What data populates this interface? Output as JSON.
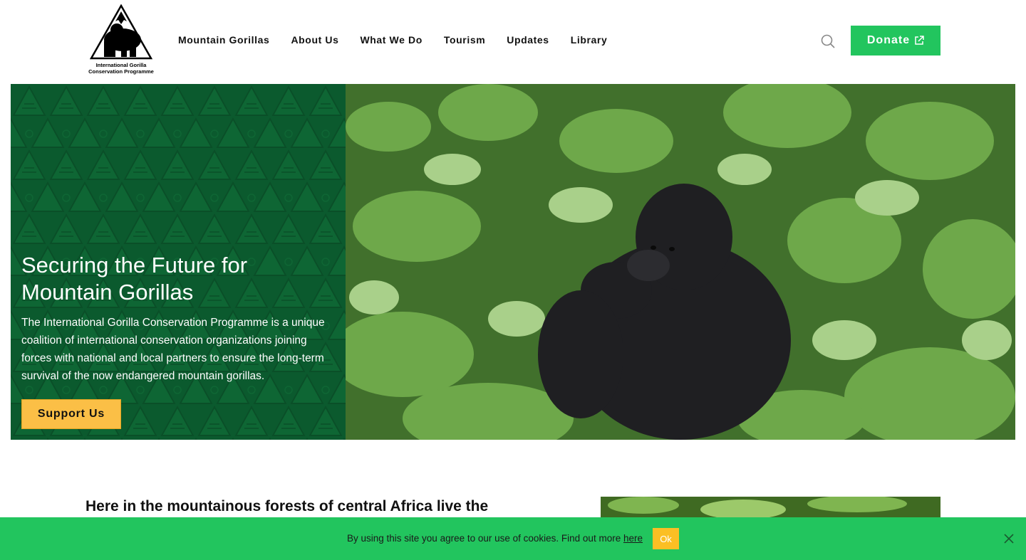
{
  "header": {
    "logo_text_line1": "International Gorilla",
    "logo_text_line2": "Conservation Programme",
    "nav": [
      "Mountain Gorillas",
      "About Us",
      "What We Do",
      "Tourism",
      "Updates",
      "Library"
    ],
    "donate_label": "Donate"
  },
  "hero": {
    "title": "Securing the Future for Mountain Gorillas",
    "description": "The International Gorilla Conservation Programme is a unique coalition of international conservation organizations joining forces with national and local partners to ensure the long-term survival of the now endangered mountain gorillas.",
    "cta_label": "Support Us"
  },
  "intro": {
    "heading": "Here in the mountainous forests of central Africa live the"
  },
  "cookie": {
    "text": "By using this site you agree to our use of cookies. Find out more",
    "link_label": "here",
    "ok_label": "Ok"
  },
  "colors": {
    "brand_green": "#22c55e",
    "hero_green": "#0b5a2e",
    "accent_yellow": "#fbbf46"
  },
  "icons": [
    "gorilla-logo-icon",
    "search-icon",
    "external-link-icon",
    "close-icon"
  ]
}
